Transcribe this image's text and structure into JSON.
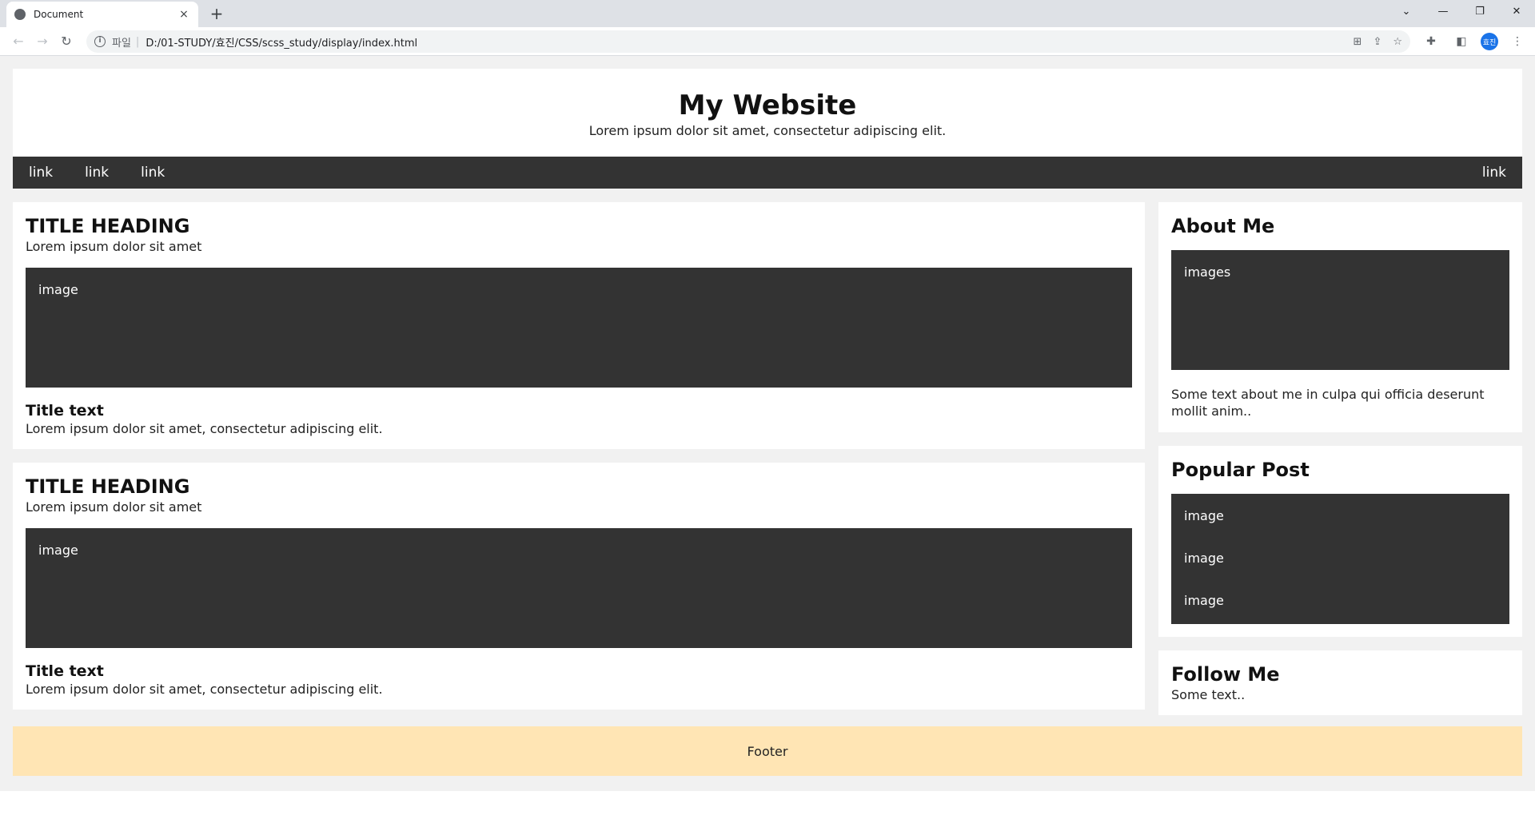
{
  "browser": {
    "tab_title": "Document",
    "tab_close": "×",
    "new_tab": "+",
    "url_protocol": "파일",
    "url_separator": "|",
    "url": "D:/01-STUDY/효진/CSS/scss_study/display/index.html",
    "profile_initials": "효진",
    "window_controls": [
      "⌄",
      "—",
      "❐",
      "✕"
    ]
  },
  "header": {
    "title": "My Website",
    "subtitle": "Lorem ipsum dolor sit amet, consectetur adipiscing elit."
  },
  "nav": {
    "links": [
      "link",
      "link",
      "link"
    ],
    "right_link": "link"
  },
  "posts": [
    {
      "heading": "TITLE HEADING",
      "subheading": "Lorem ipsum dolor sit amet",
      "image_label": "image",
      "title_text": "Title text",
      "body": "Lorem ipsum dolor sit amet, consectetur adipiscing elit."
    },
    {
      "heading": "TITLE HEADING",
      "subheading": "Lorem ipsum dolor sit amet",
      "image_label": "image",
      "title_text": "Title text",
      "body": "Lorem ipsum dolor sit amet, consectetur adipiscing elit."
    }
  ],
  "sidebar": {
    "about": {
      "heading": "About Me",
      "image_label": "images",
      "text": "Some text about me in culpa qui officia deserunt mollit anim.."
    },
    "popular": {
      "heading": "Popular Post",
      "items": [
        "image",
        "image",
        "image"
      ]
    },
    "follow": {
      "heading": "Follow Me",
      "text": "Some text.."
    }
  },
  "footer": {
    "text": "Footer"
  }
}
